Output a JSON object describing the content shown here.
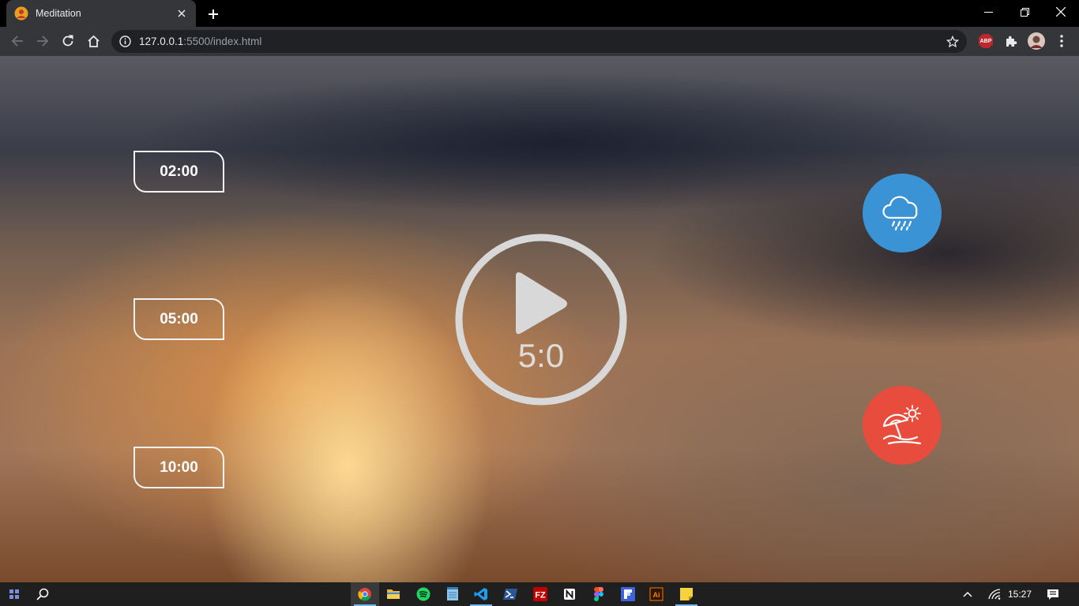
{
  "browser": {
    "tab_title": "Meditation",
    "url_host": "127.0.0.1",
    "url_rest": ":5500/index.html",
    "extension_abp": "ABP"
  },
  "app": {
    "timer_options": [
      "02:00",
      "05:00",
      "10:00"
    ],
    "time_display": "5:0",
    "sound_buttons": [
      {
        "name": "rain",
        "color": "#3a93d4"
      },
      {
        "name": "beach",
        "color": "#e84c3d"
      }
    ]
  },
  "taskbar": {
    "clock": "15:27",
    "apps": [
      "chrome",
      "file-explorer",
      "spotify",
      "notepad",
      "vscode",
      "powershell",
      "filezilla",
      "notion",
      "figma",
      "flipboard",
      "illustrator",
      "sticky-notes"
    ]
  }
}
